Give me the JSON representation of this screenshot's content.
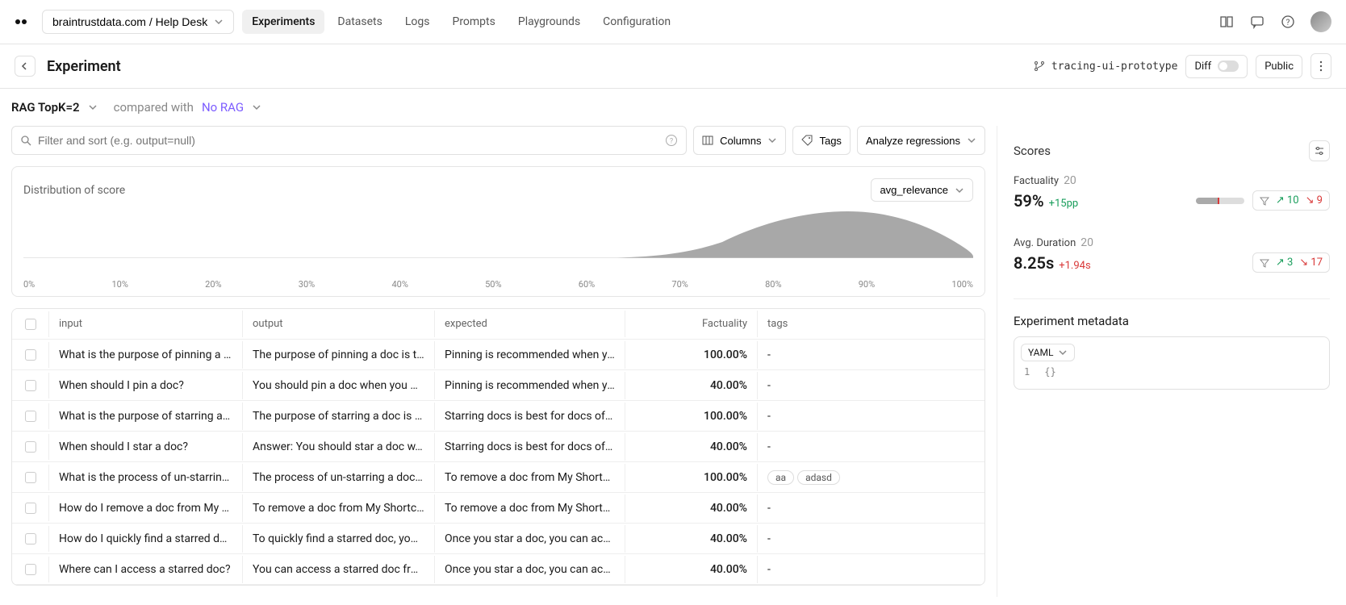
{
  "header": {
    "breadcrumb": "braintrustdata.com / Help Desk",
    "tabs": [
      "Experiments",
      "Datasets",
      "Logs",
      "Prompts",
      "Playgrounds",
      "Configuration"
    ],
    "active_tab": 0
  },
  "subheader": {
    "title": "Experiment",
    "branch": "tracing-ui-prototype",
    "diff_label": "Diff",
    "public_label": "Public"
  },
  "experiment": {
    "name": "RAG TopK=2",
    "compared_label": "compared with",
    "baseline": "No RAG"
  },
  "toolbar": {
    "search_placeholder": "Filter and sort (e.g. output=null)",
    "columns_label": "Columns",
    "tags_label": "Tags",
    "analyze_label": "Analyze regressions"
  },
  "distribution": {
    "title": "Distribution of score",
    "metric": "avg_relevance",
    "x_ticks": [
      "0%",
      "10%",
      "20%",
      "30%",
      "40%",
      "50%",
      "60%",
      "70%",
      "80%",
      "90%",
      "100%"
    ]
  },
  "table": {
    "headers": {
      "input": "input",
      "output": "output",
      "expected": "expected",
      "factuality": "Factuality",
      "tags": "tags"
    },
    "rows": [
      {
        "input": "What is the purpose of pinning a …",
        "output": "The purpose of pinning a doc is t…",
        "expected": "Pinning is recommended when yo…",
        "factuality": "100.00%",
        "tags": []
      },
      {
        "input": "When should I pin a doc?",
        "output": "You should pin a doc when you …",
        "expected": "Pinning is recommended when yo…",
        "factuality": "40.00%",
        "tags": []
      },
      {
        "input": "What is the purpose of starring a…",
        "output": "The purpose of starring a doc is …",
        "expected": "Starring docs is best for docs of …",
        "factuality": "100.00%",
        "tags": []
      },
      {
        "input": "When should I star a doc?",
        "output": "Answer: You should star a doc w…",
        "expected": "Starring docs is best for docs of …",
        "factuality": "40.00%",
        "tags": []
      },
      {
        "input": "What is the process of un-starrin…",
        "output": "The process of un-starring a doc…",
        "expected": "To remove a doc from My Shortc…",
        "factuality": "100.00%",
        "tags": [
          "aa",
          "adasd"
        ]
      },
      {
        "input": "How do I remove a doc from My …",
        "output": "To remove a doc from My Shortc…",
        "expected": "To remove a doc from My Shortc…",
        "factuality": "40.00%",
        "tags": []
      },
      {
        "input": "How do I quickly find a starred d…",
        "output": "To quickly find a starred doc, yo…",
        "expected": "Once you star a doc, you can acc…",
        "factuality": "40.00%",
        "tags": []
      },
      {
        "input": "Where can I access a starred doc?",
        "output": "You can access a starred doc fro…",
        "expected": "Once you star a doc, you can acc…",
        "factuality": "40.00%",
        "tags": []
      }
    ]
  },
  "scores": {
    "title": "Scores",
    "items": [
      {
        "label": "Factuality",
        "count": "20",
        "value": "59%",
        "delta": "+15pp",
        "delta_color": "green",
        "improvements": "10",
        "regressions": "9",
        "spark": true
      },
      {
        "label": "Avg. Duration",
        "count": "20",
        "value": "8.25s",
        "delta": "+1.94s",
        "delta_color": "red",
        "improvements": "3",
        "regressions": "17",
        "spark": false
      }
    ]
  },
  "metadata": {
    "title": "Experiment metadata",
    "format": "YAML",
    "line_no": "1",
    "content": "{}"
  },
  "chart_data": {
    "type": "area",
    "title": "Distribution of score",
    "xlabel": "",
    "ylabel": "",
    "x_ticks": [
      0,
      10,
      20,
      30,
      40,
      50,
      60,
      70,
      80,
      90,
      100
    ],
    "series": [
      {
        "name": "avg_relevance",
        "x": [
          0,
          10,
          20,
          30,
          40,
          50,
          60,
          65,
          70,
          75,
          80,
          85,
          90,
          95,
          100
        ],
        "y": [
          0,
          0,
          0,
          0,
          0,
          0,
          1,
          3,
          10,
          25,
          50,
          78,
          60,
          30,
          8
        ]
      }
    ],
    "xlim": [
      0,
      100
    ]
  }
}
